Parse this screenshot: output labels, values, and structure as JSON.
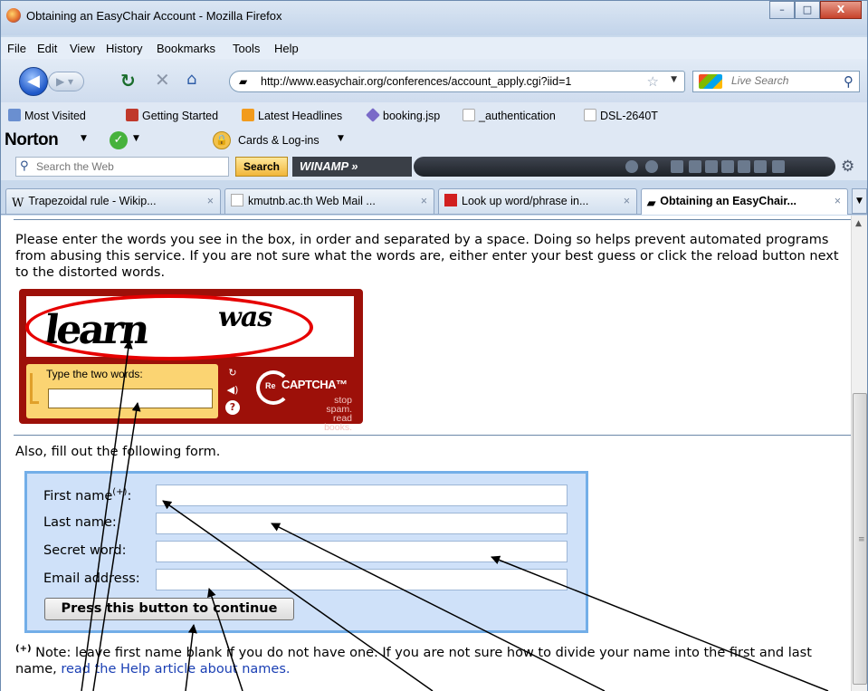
{
  "window": {
    "title": "Obtaining an EasyChair Account - Mozilla Firefox",
    "minimize_glyph": "–",
    "maximize_glyph": "□",
    "close_glyph": "X"
  },
  "menu": [
    "File",
    "Edit",
    "View",
    "History",
    "Bookmarks",
    "Tools",
    "Help"
  ],
  "nav": {
    "url": "http://www.easychair.org/conferences/account_apply.cgi?iid=1",
    "search_placeholder": "Live Search"
  },
  "bookmarks": [
    "Most Visited",
    "Getting Started",
    "Latest Headlines",
    "booking.jsp",
    "_authentication",
    "DSL-2640T"
  ],
  "norton": {
    "logo": "Norton",
    "cards_label": "Cards & Log-ins"
  },
  "webbar": {
    "search_placeholder": "Search the Web",
    "search_button": "Search",
    "winamp_label": "WINAMP »"
  },
  "tabs": [
    {
      "label": "Trapezoidal rule - Wikip...",
      "active": false
    },
    {
      "label": "kmutnb.ac.th Web Mail ...",
      "active": false
    },
    {
      "label": "Look up word/phrase in...",
      "active": false
    },
    {
      "label": "Obtaining an EasyChair...",
      "active": true
    }
  ],
  "page": {
    "instructions": "Please enter the words you see in the box, in order and separated by a space. Doing so helps prevent automated programs from abusing this service. If you are not sure what the words are, either enter your best guess or click the reload button next to the distorted words.",
    "captcha": {
      "word1": "learn",
      "word2": "was",
      "input_label": "Type the two words:",
      "brand_prefix": "Re",
      "brand_name": "CAPTCHA™",
      "tagline": "stop spam. read books."
    },
    "form_intro": "Also, fill out the following form.",
    "form": {
      "first_name_label": "First name",
      "first_name_marker": "(+)",
      "first_name_suffix": ":",
      "last_name_label": "Last name:",
      "secret_word_label": "Secret word:",
      "email_label": "Email address:",
      "submit_label": "Press this button to continue"
    },
    "footnote": {
      "marker": "(+)",
      "text": " Note: leave first name blank if you do not have one. If you are not sure how to divide your name into the first and last name, ",
      "link": "read the Help article about names."
    }
  },
  "colors": {
    "recaptcha_red": "#9d1009",
    "captcha_yellow": "#fbd472",
    "form_panel_bg": "#cfe1f9",
    "form_panel_border": "#73aee8",
    "annotation_red": "#e60000",
    "link_blue": "#1a3fb4"
  }
}
